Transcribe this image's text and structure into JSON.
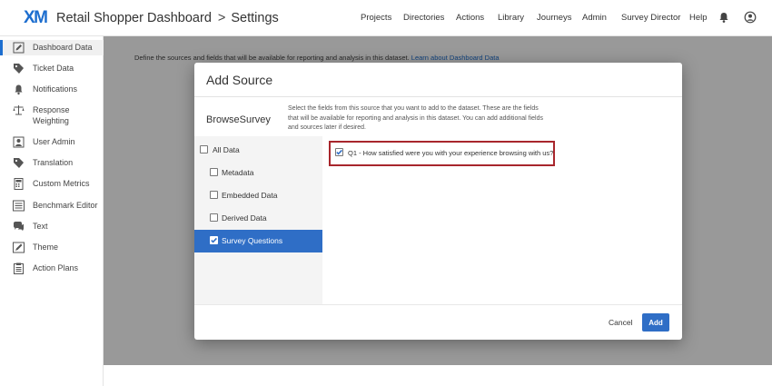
{
  "header": {
    "logo": "XM",
    "project": "Retail Shopper Dashboard",
    "separator": ">",
    "section": "Settings",
    "nav": [
      "Projects",
      "Directories",
      "Actions",
      "Library",
      "Journeys",
      "Admin",
      "Survey Director",
      "Help"
    ],
    "icons": [
      "bell-icon",
      "user-icon"
    ]
  },
  "sidebar": {
    "items": [
      {
        "label": "Dashboard Data",
        "icon": "pencil-icon"
      },
      {
        "label": "Ticket Data",
        "icon": "tag-icon"
      },
      {
        "label": "Notifications",
        "icon": "bell-icon"
      },
      {
        "label": "Response Weighting",
        "icon": "scale-icon"
      },
      {
        "label": "User Admin",
        "icon": "user-icon"
      },
      {
        "label": "Translation",
        "icon": "tag-icon"
      },
      {
        "label": "Custom Metrics",
        "icon": "calculator-icon"
      },
      {
        "label": "Benchmark Editor",
        "icon": "list-icon"
      },
      {
        "label": "Text",
        "icon": "chat-icon"
      },
      {
        "label": "Theme",
        "icon": "paint-icon"
      },
      {
        "label": "Action Plans",
        "icon": "clipboard-icon"
      }
    ],
    "active_index": 0
  },
  "content": {
    "description": "Define the sources and fields that will be available for reporting and analysis in this dataset.",
    "learn_link": "Learn about Dashboard Data"
  },
  "modal": {
    "title": "Add Source",
    "source_name": "BrowseSurvey",
    "intro": "Select the fields from this source that you want to add to the dataset. These are the fields that will be available for reporting and analysis in this dataset. You can add additional fields and sources later if desired.",
    "categories": [
      {
        "label": "All Data",
        "checked": false
      },
      {
        "label": "Metadata",
        "checked": false
      },
      {
        "label": "Embedded Data",
        "checked": false
      },
      {
        "label": "Derived Data",
        "checked": false
      },
      {
        "label": "Survey Questions",
        "checked": true
      }
    ],
    "selected_category": "Survey Questions",
    "fields": [
      {
        "label": "Q1 - How satisfied were you with your experience browsing with us?",
        "checked": true
      }
    ],
    "cancel_label": "Cancel",
    "add_label": "Add"
  },
  "colors": {
    "accent": "#2f6ec6",
    "highlight": "#a8262c"
  }
}
